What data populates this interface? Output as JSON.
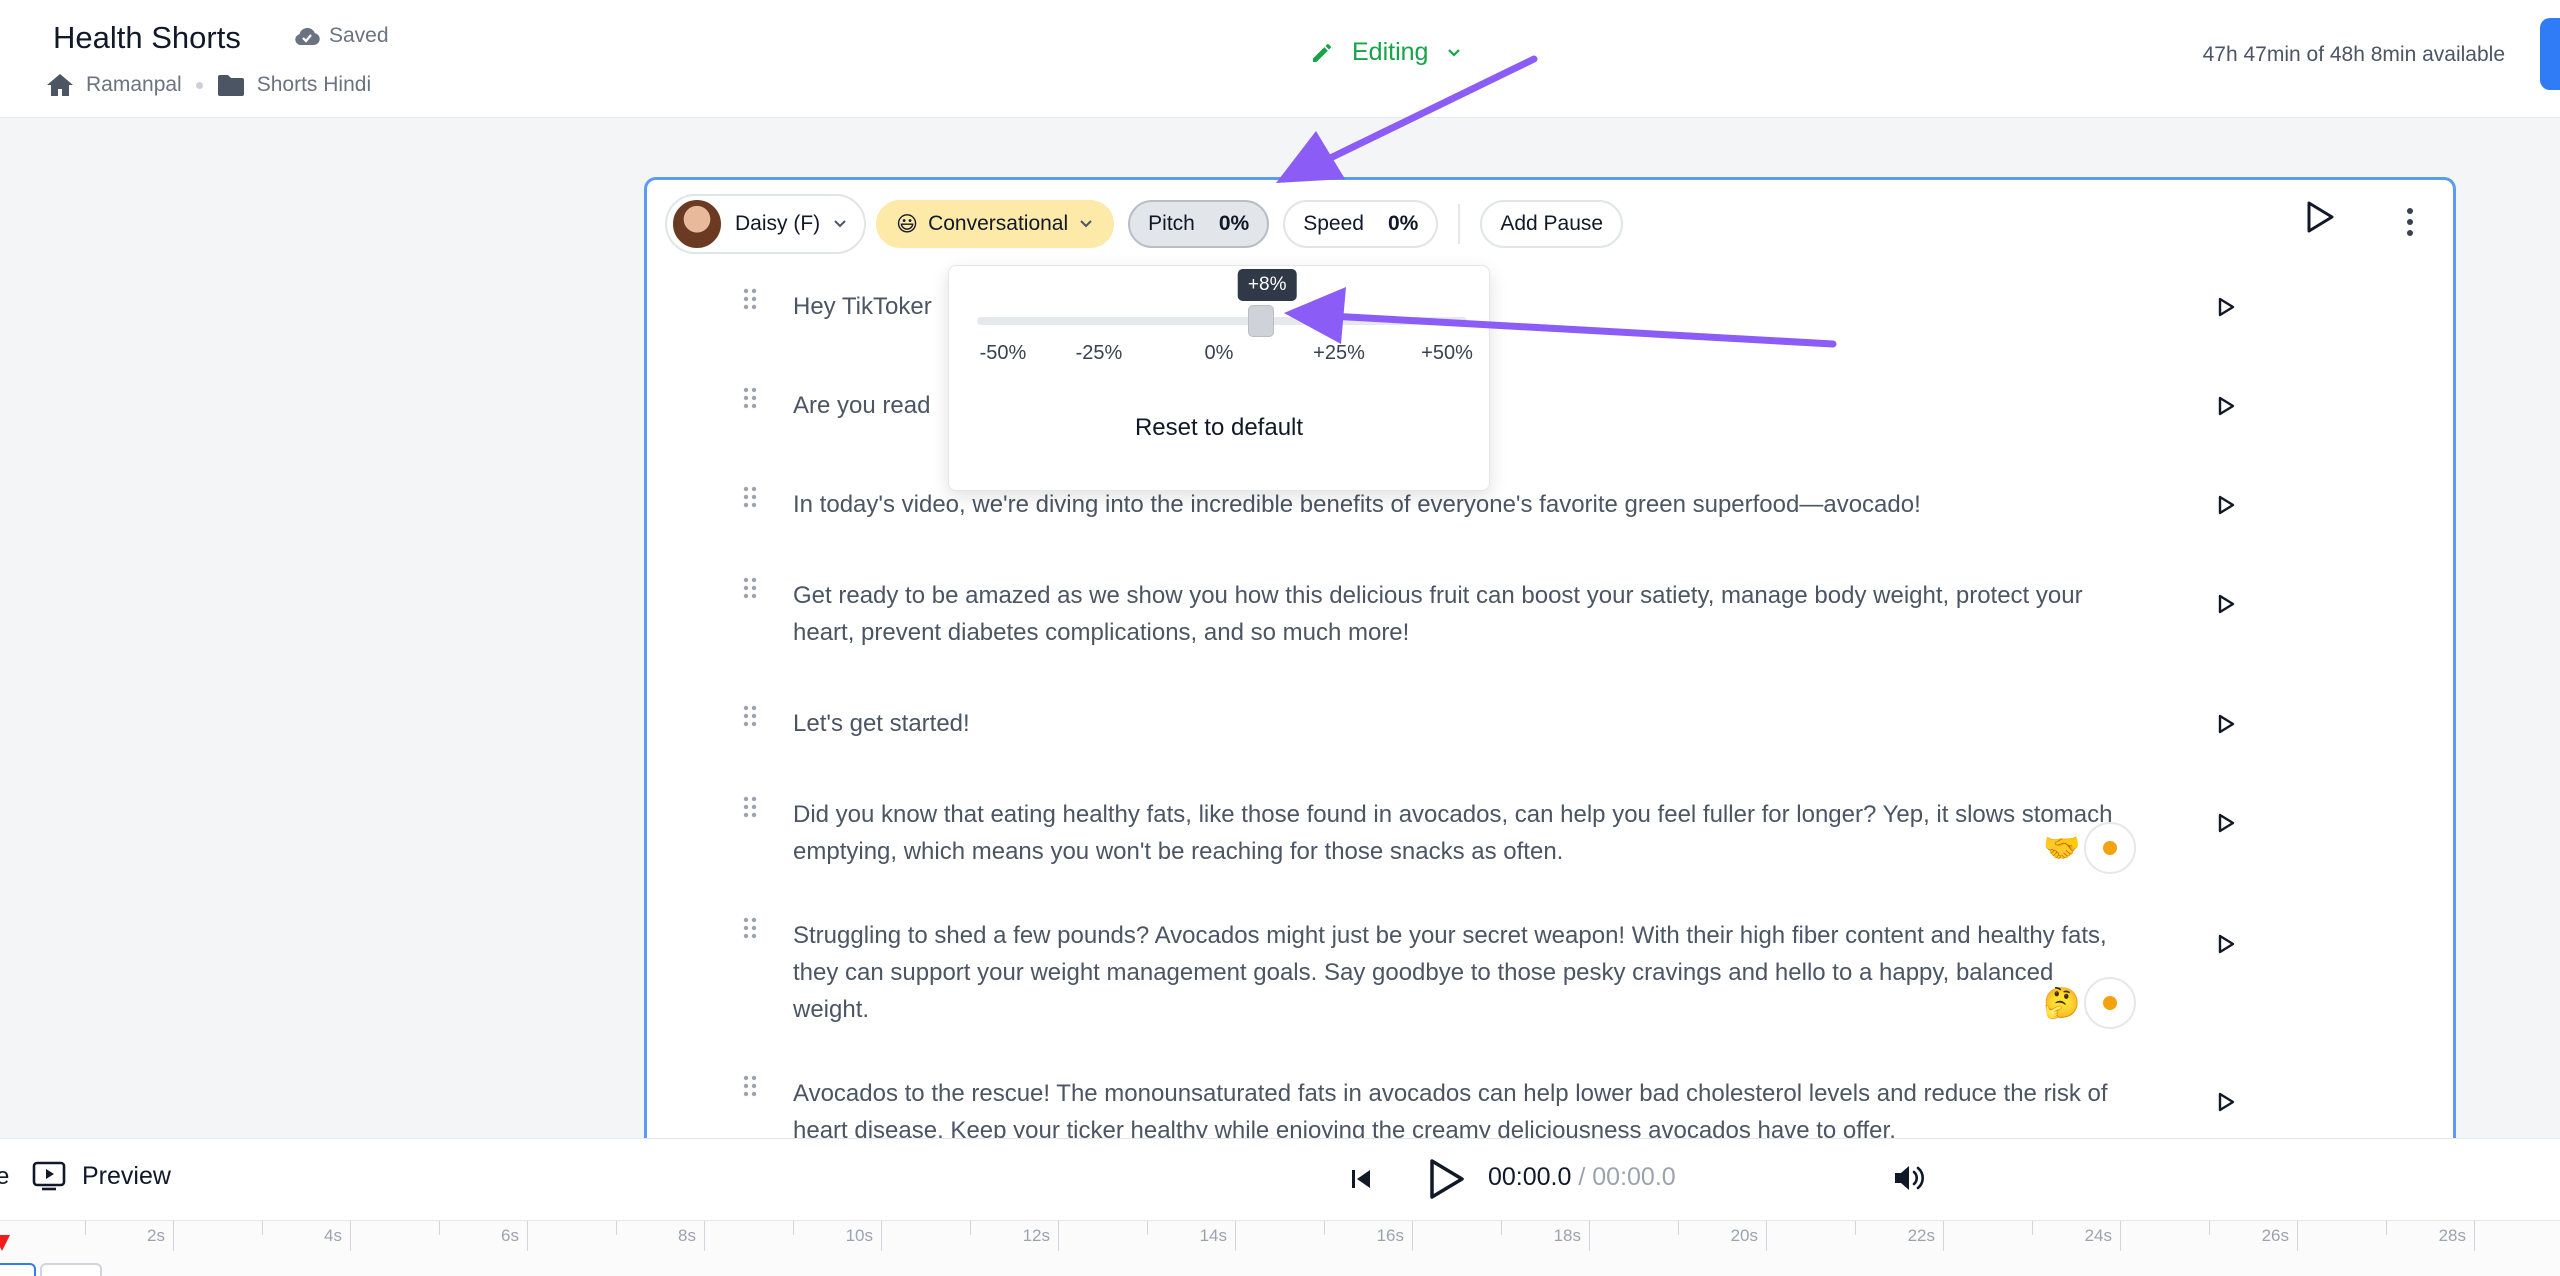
{
  "header": {
    "title": "Health Shorts",
    "saved_label": "Saved",
    "breadcrumbs": [
      {
        "label": "Ramanpal",
        "icon": "home-icon"
      },
      {
        "label": "Shorts Hindi",
        "icon": "folder-icon"
      }
    ],
    "mode_label": "Editing",
    "availability": "47h 47min of 48h 8min available"
  },
  "toolbar": {
    "voice": "Daisy (F)",
    "style_emoji": "😃",
    "style": "Conversational",
    "pitch_label": "Pitch",
    "pitch_value": "0%",
    "speed_label": "Speed",
    "speed_value": "0%",
    "add_pause": "Add Pause"
  },
  "pitch_popup": {
    "tooltip": "+8%",
    "current_value": 8,
    "range": [
      -50,
      50
    ],
    "ticks": [
      "-50%",
      "-25%",
      "0%",
      "+25%",
      "+50%"
    ],
    "reset_label": "Reset to default"
  },
  "paragraphs": [
    {
      "text": "Hey TikToker"
    },
    {
      "text": "Are you read"
    },
    {
      "text": "In today's video, we're diving into the incredible benefits of everyone's favorite green superfood—avocado!"
    },
    {
      "text": "Get ready to be amazed as we show you how this delicious fruit can boost your satiety, manage body weight, protect your heart, prevent diabetes complications, and so much more!"
    },
    {
      "text": "Let's get started!"
    },
    {
      "text": "Did you know that eating healthy fats, like those found in avocados, can help you feel fuller for longer? Yep, it slows stomach emptying, which means you won't be reaching for those snacks as often.",
      "emoji": "🤝"
    },
    {
      "text": "Struggling to shed a few pounds? Avocados might just be your secret weapon!  With their high fiber content and healthy fats, they can support your weight management goals. Say goodbye to those pesky cravings and hello to a happy, balanced weight.",
      "emoji": "🤔"
    },
    {
      "text": "Avocados to the rescue! The monounsaturated fats in avocados can help lower bad cholesterol levels and reduce the risk of heart disease. Keep your ticker healthy while enjoying the creamy deliciousness avocados have to offer."
    }
  ],
  "player": {
    "edge_text": "e",
    "preview_label": "Preview",
    "current_time": "00:00.0",
    "separator": " / ",
    "duration": "00:00.0"
  },
  "timeline": {
    "labels": [
      "2s",
      "4s",
      "6s",
      "8s",
      "10s",
      "12s",
      "14s",
      "16s",
      "18s",
      "20s",
      "22s",
      "24s",
      "26s",
      "28s"
    ]
  },
  "colors": {
    "accent_blue": "#2f7cf6",
    "editing_green": "#16a34a",
    "annotation_arrow": "#8b5cf6",
    "playhead_red": "#ef1c1c"
  }
}
